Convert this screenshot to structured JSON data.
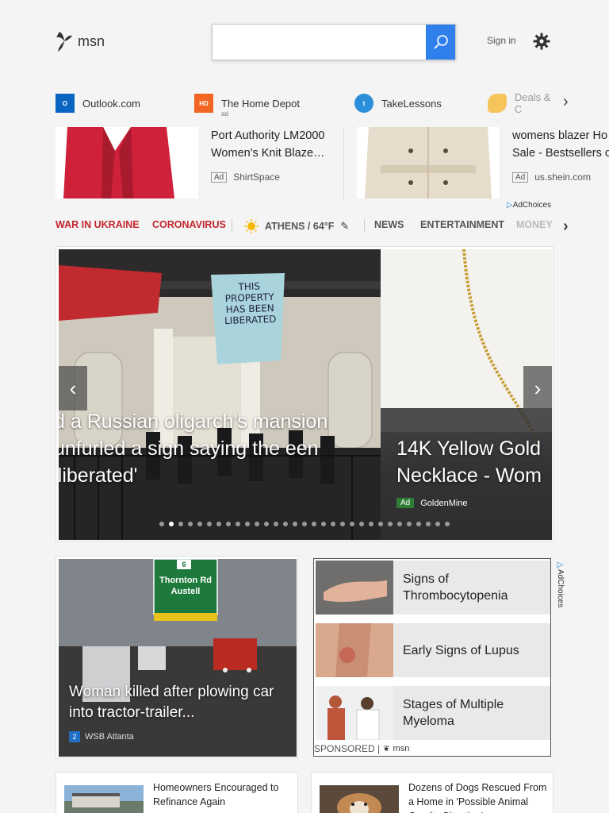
{
  "header": {
    "logo_text": "msn",
    "search": {
      "value": "",
      "placeholder": ""
    },
    "sign_in": "Sign in"
  },
  "quick_links": [
    {
      "label": "Outlook.com",
      "icon": "outlook-icon",
      "sub": ""
    },
    {
      "label": "The Home Depot",
      "icon": "home-depot-icon",
      "sub": "ad"
    },
    {
      "label": "TakeLessons",
      "icon": "takelessons-icon",
      "sub": ""
    },
    {
      "label": "Deals & C",
      "icon": "deals-icon",
      "sub": ""
    }
  ],
  "ads": [
    {
      "title1": "Port Authority LM2000",
      "title2": "Women's Knit Blaze…",
      "badge": "Ad",
      "source": "ShirtSpace"
    },
    {
      "title1": "womens blazer Ho",
      "title2": "Sale - Bestsellers o",
      "badge": "Ad",
      "source": "us.shein.com"
    }
  ],
  "adchoices": "AdChoices",
  "nav": {
    "items": [
      "WAR IN UKRAINE",
      "CORONAVIRUS",
      "ATHENS / 64°F",
      "NEWS",
      "ENTERTAINMENT",
      "MONEY"
    ]
  },
  "hero": {
    "left_title": "d a Russian oligarch's mansion unfurled a sign saying the een 'liberated'",
    "banner_text": "THIS PROPERTY HAS BEEN LIBERATED",
    "right_title": "14K Yellow Gold Necklace - Wom",
    "right_ad_badge": "Ad",
    "right_ad_source": "GoldenMine",
    "slide_count": 31,
    "active_slide": 2
  },
  "news": {
    "title": "Woman killed after plowing car into tractor-trailer...",
    "source": "WSB Atlanta",
    "sign_line1": "Thornton Rd",
    "sign_line2": "Austell",
    "sign_route": "6"
  },
  "sponsored": {
    "items": [
      "Signs of Thrombocytopenia",
      "Early Signs of Lupus",
      "Stages of Multiple Myeloma"
    ],
    "footer": "SPONSORED |",
    "footer_brand": "msn"
  },
  "small_tiles": [
    {
      "title": "Homeowners Encouraged to Refinance Again"
    },
    {
      "title": "Dozens of Dogs Rescued From a Home in 'Possible Animal Cruelty Situation'"
    }
  ],
  "colors": {
    "accent": "#2f80ed",
    "nav_red": "#c4262e",
    "ad_green": "#2e7d32"
  }
}
